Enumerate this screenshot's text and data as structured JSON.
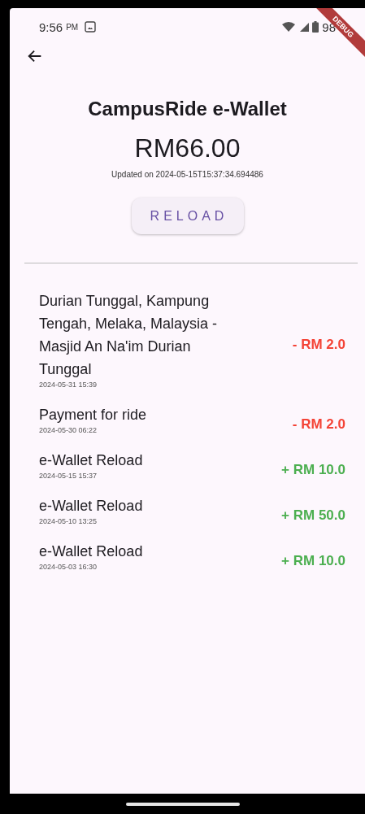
{
  "status_bar": {
    "time": "9:56",
    "meridiem": "PM",
    "battery": "98"
  },
  "debug_banner": "DEBUG",
  "title": "CampusRide e-Wallet",
  "balance": "RM66.00",
  "updated": "Updated on 2024-05-15T15:37:34.694486",
  "reload_button": "RELOAD",
  "transactions": [
    {
      "description": "Durian Tunggal, Kampung Tengah, Melaka, Malaysia - Masjid An Na'im Durian Tunggal",
      "date": "2024-05-31 15:39",
      "amount": "- RM 2.0",
      "kind": "debit"
    },
    {
      "description": "Payment for ride",
      "date": "2024-05-30 06:22",
      "amount": "- RM 2.0",
      "kind": "debit"
    },
    {
      "description": "e-Wallet Reload",
      "date": "2024-05-15 15:37",
      "amount": "+ RM 10.0",
      "kind": "credit"
    },
    {
      "description": "e-Wallet Reload",
      "date": "2024-05-10 13:25",
      "amount": "+ RM 50.0",
      "kind": "credit"
    },
    {
      "description": "e-Wallet Reload",
      "date": "2024-05-03 16:30",
      "amount": "+ RM 10.0",
      "kind": "credit"
    }
  ]
}
